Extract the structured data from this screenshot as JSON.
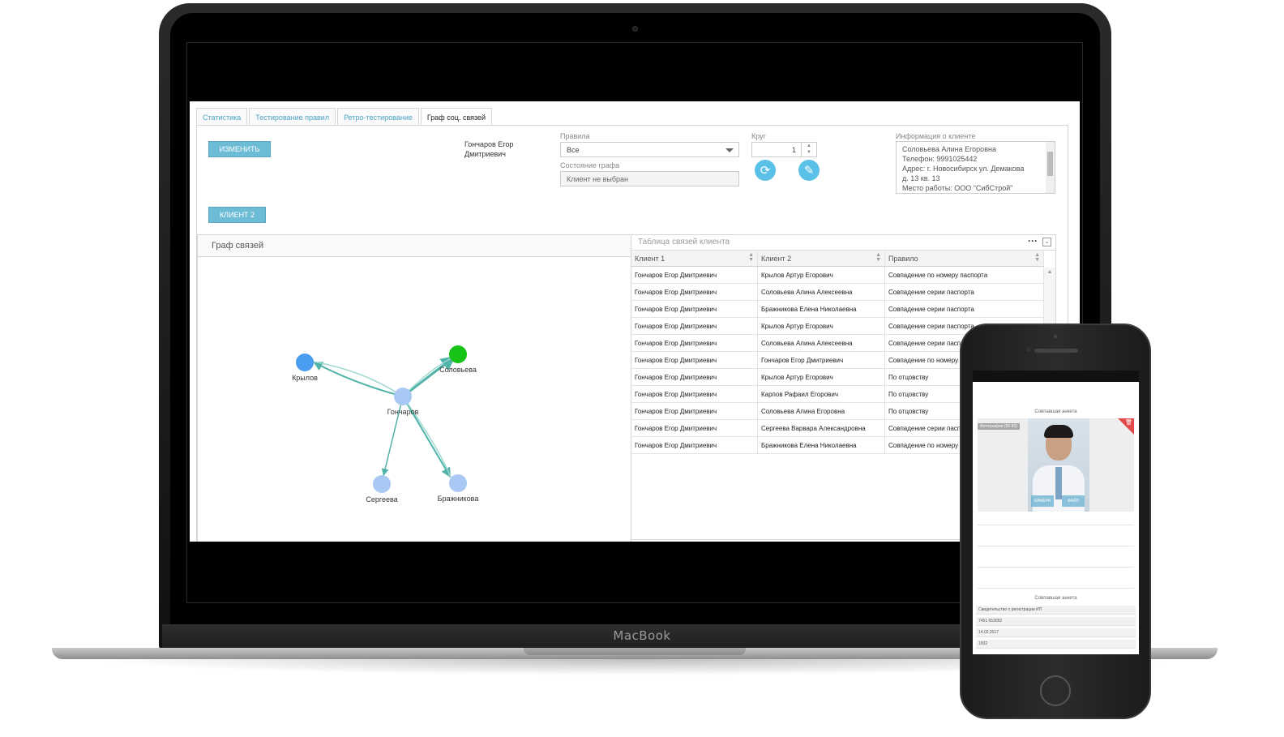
{
  "device_label": "MacBook",
  "tabs": [
    "Статистика",
    "Тестирование правил",
    "Ретро-тестирование",
    "Граф соц. связей"
  ],
  "active_tab": 3,
  "buttons": {
    "change": "ИЗМЕНИТЬ",
    "client2": "КЛИЕНТ 2"
  },
  "client_name": "Гончаров Егор Дмитриевич",
  "filters": {
    "rules_label": "Правила",
    "rules_value": "Все",
    "graph_state_label": "Состояние графа",
    "graph_state_value": "Клиент не выбран",
    "circle_label": "Круг",
    "circle_value": "1",
    "client_info_label": "Информация о клиенте",
    "client_info_lines": [
      "Соловьева Алина Егоровна",
      "Телефон: 9991025442",
      "Адрес: г. Новосибирск ул. Демакова",
      "д. 13 кв. 13",
      "Место работы: ООО \"СибСтрой\""
    ]
  },
  "graph": {
    "title": "Граф связей",
    "nodes": [
      "Крылов",
      "Соловьева",
      "Гончаров",
      "Сергеева",
      "Бражникова"
    ],
    "colors": {
      "node": "#a9c9f4",
      "selected": "#4a9df0",
      "target": "#17c317",
      "edge": "#4fb3a8"
    }
  },
  "table": {
    "title": "Таблица связей клиента",
    "columns": [
      "Клиент 1",
      "Клиент 2",
      "Правило"
    ],
    "rows": [
      [
        "Гончаров Егор Дмитриевич",
        "Крылов Артур Егорович",
        "Совпадение по номеру паспорта"
      ],
      [
        "Гончаров Егор Дмитриевич",
        "Соловьева Алина Алексеевна",
        "Совпадение серии паспорта"
      ],
      [
        "Гончаров Егор Дмитриевич",
        "Бражникова Елена Николаевна",
        "Совпадение серии паспорта"
      ],
      [
        "Гончаров Егор Дмитриевич",
        "Крылов Артур Егорович",
        "Совпадение серии паспорта"
      ],
      [
        "Гончаров Егор Дмитриевич",
        "Соловьева Алина Алексеевна",
        "Совпадение серии паспорта"
      ],
      [
        "Гончаров Егор Дмитриевич",
        "Гончаров Егор Дмитриевич",
        "Совпадение по номеру паспорта"
      ],
      [
        "Гончаров Егор Дмитриевич",
        "Крылов Артур Егорович",
        "По отцовству"
      ],
      [
        "Гончаров Егор Дмитриевич",
        "Карпов Рафаил Егорович",
        "По отцовству"
      ],
      [
        "Гончаров Егор Дмитриевич",
        "Соловьева Алина Егоровна",
        "По отцовству"
      ],
      [
        "Гончаров Егор Дмитриевич",
        "Сергеева Варвара Александровна",
        "Совпадение серии паспорта"
      ],
      [
        "Гончаров Егор Дмитриевич",
        "Бражникова Елена Николаевна",
        "Совпадение по номеру паспорта"
      ]
    ]
  },
  "phone": {
    "header": "Совпавшая анкета",
    "photo_tag": "Фотография (56 Кб)",
    "camera_btn": "КАМЕРА",
    "file_btn": "ФАЙЛ",
    "header2": "Совпавшая анкета",
    "fields": [
      "Свидетельство о регистрации ИП",
      "7451 653092",
      "14.02.2017",
      "1502"
    ]
  }
}
